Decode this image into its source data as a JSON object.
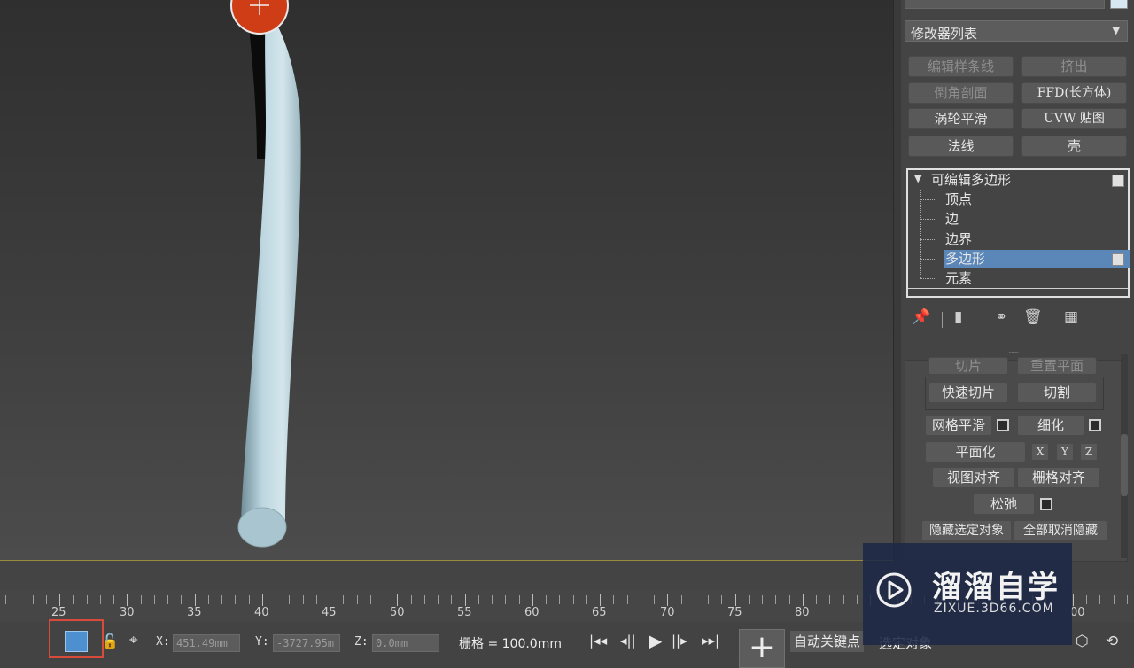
{
  "command_panel": {
    "modifier_list": "修改器列表",
    "buttons": [
      {
        "label": "编辑样条线",
        "enabled": false
      },
      {
        "label": "挤出",
        "enabled": false
      },
      {
        "label": "倒角剖面",
        "enabled": false
      },
      {
        "label": "FFD(长方体)",
        "enabled": true
      },
      {
        "label": "涡轮平滑",
        "enabled": true
      },
      {
        "label": "UVW 贴图",
        "enabled": true
      },
      {
        "label": "法线",
        "enabled": true
      },
      {
        "label": "壳",
        "enabled": true
      }
    ],
    "stack": {
      "root": "可编辑多边形",
      "sub_items": [
        "顶点",
        "边",
        "边界",
        "多边形",
        "元素"
      ],
      "selected": "多边形"
    },
    "rollout": {
      "clipped_row": [
        "切片",
        "重置平面"
      ],
      "quick_slice": "快速切片",
      "cut": "切割",
      "mesh_smooth": "网格平滑",
      "tessellate": "细化",
      "make_planar": "平面化",
      "axes": [
        "X",
        "Y",
        "Z"
      ],
      "view_align": "视图对齐",
      "grid_align": "栅格对齐",
      "relax": "松弛",
      "hide_selected": "隐藏选定对象",
      "unhide_all": "全部取消隐藏"
    }
  },
  "timeline": {
    "labels": [
      "25",
      "30",
      "35",
      "40",
      "45",
      "50",
      "55",
      "60",
      "65",
      "70",
      "75",
      "80"
    ],
    "last_label_partial": "00"
  },
  "statusbar": {
    "x_label": "X:",
    "x_value": "451.49mm",
    "y_label": "Y:",
    "y_value": "-3727.95m",
    "z_label": "Z:",
    "z_value": "0.0mm",
    "grid_text": "栅格 = 100.0mm",
    "auto_key": "自动关键点",
    "selected_partial": "选定对象"
  },
  "watermark": {
    "title": "溜溜自学",
    "url": "ZIXUE.3D66.COM"
  },
  "colors": {
    "viewport_bg": "#3a3a3a",
    "selection_blue": "#5a86b8",
    "highlight_red": "#d84a3a",
    "tube": "#b9d2dc",
    "gizmo": "#d8431a"
  }
}
